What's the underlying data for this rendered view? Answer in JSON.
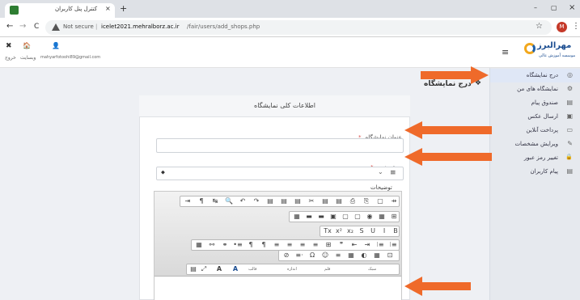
{
  "browser": {
    "tab_title": "کنترل پنل کاربران",
    "tab_close": "×",
    "new_tab": "+",
    "nav": {
      "back": "←",
      "forward": "→",
      "reload": "C"
    },
    "url": {
      "security": "Not secure",
      "separator": "|",
      "host": "icelet2021.mehralborz.ac.ir",
      "path": "/fair/users/add_shops.php"
    },
    "star": "☆",
    "profile_initial": "M",
    "menu_dots": "⋮",
    "window": {
      "minimize": "–",
      "maximize": "▢",
      "close": "×"
    }
  },
  "header": {
    "close_icon": "✖",
    "home_icon": "🏠",
    "user_icon": "👤",
    "exit_label": "خروج",
    "site_label": "وبسایت",
    "email": "mahyarfotoohi89@gmail.com",
    "hamburger": "≡",
    "logo_text": "مهرالبرز",
    "logo_sub": "موسسه آموزش عالی"
  },
  "sidebar": {
    "items": [
      {
        "label": "درج نمایشگاه",
        "icon": "◎",
        "active": true
      },
      {
        "label": "نمایشگاه های من",
        "icon": "⚙",
        "active": false
      },
      {
        "label": "صندوق پیام",
        "icon": "▤",
        "active": false
      },
      {
        "label": "ارسال عکس",
        "icon": "▣",
        "active": false
      },
      {
        "label": "پرداخت آنلاین",
        "icon": "▭",
        "active": false
      },
      {
        "label": "ویرایش مشخصات",
        "icon": "✎",
        "active": false
      },
      {
        "label": "تغییر رمز عبور",
        "icon": "🔒",
        "active": false
      },
      {
        "label": "پیام کاربران",
        "icon": "▤",
        "active": false
      }
    ]
  },
  "main": {
    "page_title": "درج نمایشگاه",
    "title_icon": "❖",
    "card_title": "اطلاعات کلی نمایشگاه",
    "fields": {
      "exhibition_title": {
        "label": "عنوان نمایشگاه",
        "required": "*",
        "value": ""
      },
      "category": {
        "label": "دسته بندی",
        "required": "*",
        "selected": "",
        "caret": "⬥",
        "list_icon": "≡",
        "arrow": "⌄"
      },
      "description": {
        "label": "توضیحات"
      }
    }
  },
  "editor": {
    "row1": [
      "⇥",
      "¶",
      "↹",
      "🔍",
      "↶",
      "↷",
      "▤",
      "▤",
      "▤",
      "✂",
      "▤",
      "▤",
      "⎙",
      "⎘",
      "▢",
      "⇸"
    ],
    "row2": [
      "▦",
      "▬",
      "▬",
      "▣",
      "▢",
      "▢",
      "◉",
      "▦",
      "⊞"
    ],
    "row3": [
      "Tx",
      "x²",
      "x₂",
      "S",
      "U",
      "I",
      "B"
    ],
    "row4": [
      "▦",
      "⚯",
      "⚭",
      "•≡",
      "¶",
      "¶",
      "≡",
      "≡",
      "≡",
      "≡",
      "⊞",
      "❞",
      "⇤",
      "⇥",
      "⁝≡",
      "⁝≡"
    ],
    "row5": [
      "⊘",
      "≡·",
      "Ω",
      "☺",
      "≡",
      "▦",
      "◐",
      "▦",
      "⊡"
    ],
    "row6": {
      "icons": [
        "▤",
        "⤢"
      ],
      "font_color": "A",
      "bg_color": "A",
      "format": "قالب",
      "size": "اندازه",
      "font": "قلم",
      "style": "سبک"
    }
  },
  "colors": {
    "accent_orange": "#ef6a2a",
    "sidebar_active": "#dfe7f6",
    "titlebar": "#dee1e6",
    "profile": "#c53929"
  }
}
